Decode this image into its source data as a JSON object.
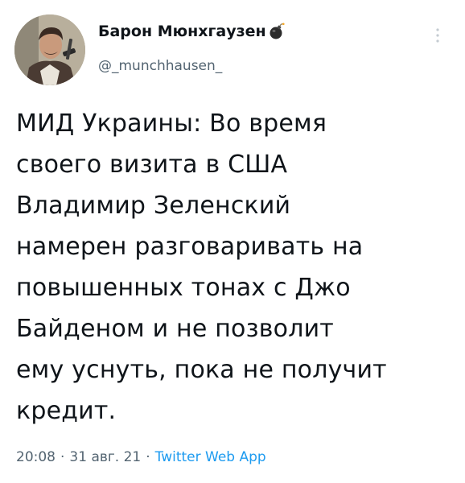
{
  "author": {
    "display_name": "Барон Мюнхгаузен",
    "handle": "@_munchhausen_",
    "badge_icon": "bomb-icon",
    "avatar_icon": "profile-avatar"
  },
  "tweet": {
    "text": "МИД Украины: Во время\nсвоего визита в США\nВладимир Зеленский\nнамерен разговаривать на\nповышенных тонах с Джо\nБайденом и не позволит\nему уснуть, пока не получит\nкредит.",
    "time": "20:08",
    "separator": "·",
    "date": "31 авг. 21",
    "source": "Twitter Web App"
  },
  "menu": {
    "more_icon": "more-options-icon"
  },
  "colors": {
    "text": "#0f1419",
    "secondary": "#536471",
    "link": "#1d9bf0",
    "background": "#ffffff"
  }
}
